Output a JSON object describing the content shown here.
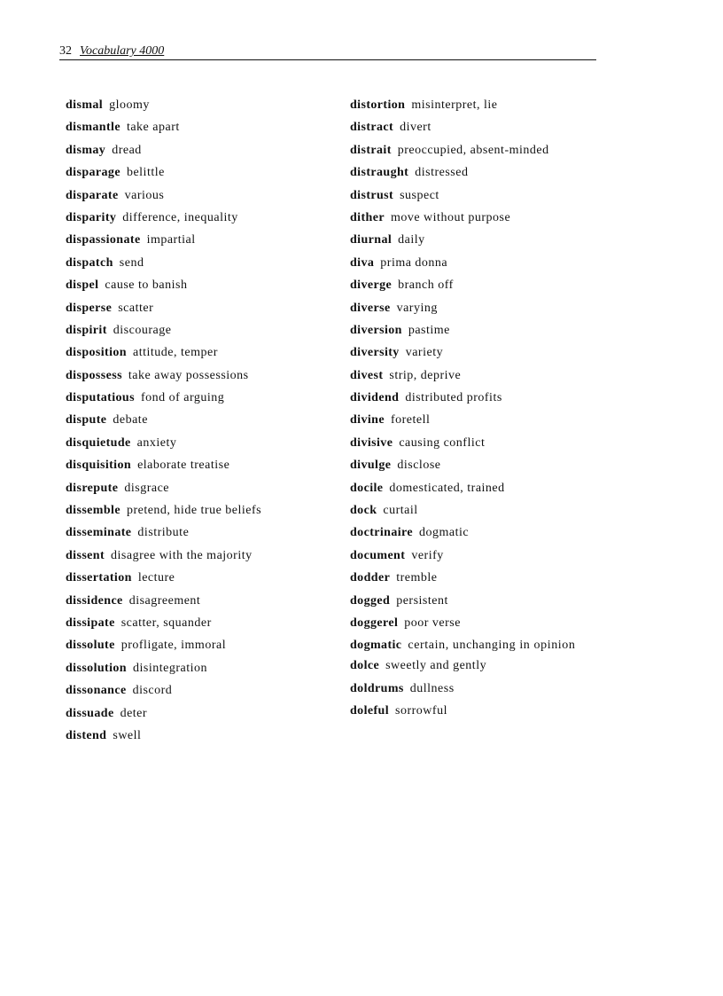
{
  "header": {
    "page_number": "32",
    "book_title": "Vocabulary 4000"
  },
  "left_column": [
    {
      "term": "dismal",
      "definition": "gloomy"
    },
    {
      "term": "dismantle",
      "definition": "take apart"
    },
    {
      "term": "dismay",
      "definition": "dread"
    },
    {
      "term": "disparage",
      "definition": "belittle"
    },
    {
      "term": "disparate",
      "definition": "various"
    },
    {
      "term": "disparity",
      "definition": "difference, inequality"
    },
    {
      "term": "dispassionate",
      "definition": "impartial"
    },
    {
      "term": "dispatch",
      "definition": "send"
    },
    {
      "term": "dispel",
      "definition": "cause to banish"
    },
    {
      "term": "disperse",
      "definition": "scatter"
    },
    {
      "term": "dispirit",
      "definition": "discourage"
    },
    {
      "term": "disposition",
      "definition": "attitude, temper"
    },
    {
      "term": "dispossess",
      "definition": "take away possessions"
    },
    {
      "term": "disputatious",
      "definition": "fond of arguing"
    },
    {
      "term": "dispute",
      "definition": "debate"
    },
    {
      "term": "disquietude",
      "definition": "anxiety"
    },
    {
      "term": "disquisition",
      "definition": "elaborate treatise"
    },
    {
      "term": "disrepute",
      "definition": "disgrace"
    },
    {
      "term": "dissemble",
      "definition": "pretend, hide true beliefs"
    },
    {
      "term": "disseminate",
      "definition": "distribute"
    },
    {
      "term": "dissent",
      "definition": "disagree with the majority"
    },
    {
      "term": "dissertation",
      "definition": "lecture"
    },
    {
      "term": "dissidence",
      "definition": "disagreement"
    },
    {
      "term": "dissipate",
      "definition": "scatter, squander"
    },
    {
      "term": "dissolute",
      "definition": "profligate, immoral"
    },
    {
      "term": "dissolution",
      "definition": "disintegration"
    },
    {
      "term": "dissonance",
      "definition": "discord"
    },
    {
      "term": "dissuade",
      "definition": "deter"
    },
    {
      "term": "distend",
      "definition": "swell"
    }
  ],
  "right_column": [
    {
      "term": "distortion",
      "definition": "misinterpret, lie"
    },
    {
      "term": "distract",
      "definition": "divert"
    },
    {
      "term": "distrait",
      "definition": "preoccupied, absent-minded"
    },
    {
      "term": "distraught",
      "definition": "distressed"
    },
    {
      "term": "distrust",
      "definition": "suspect"
    },
    {
      "term": "dither",
      "definition": "move without purpose"
    },
    {
      "term": "diurnal",
      "definition": "daily"
    },
    {
      "term": "diva",
      "definition": "prima donna"
    },
    {
      "term": "diverge",
      "definition": "branch off"
    },
    {
      "term": "diverse",
      "definition": "varying"
    },
    {
      "term": "diversion",
      "definition": "pastime"
    },
    {
      "term": "diversity",
      "definition": "variety"
    },
    {
      "term": "divest",
      "definition": "strip, deprive"
    },
    {
      "term": "dividend",
      "definition": "distributed profits"
    },
    {
      "term": "divine",
      "definition": "foretell"
    },
    {
      "term": "divisive",
      "definition": "causing conflict"
    },
    {
      "term": "divulge",
      "definition": "disclose"
    },
    {
      "term": "docile",
      "definition": "domesticated, trained"
    },
    {
      "term": "dock",
      "definition": "curtail"
    },
    {
      "term": "doctrinaire",
      "definition": "dogmatic"
    },
    {
      "term": "document",
      "definition": "verify"
    },
    {
      "term": "dodder",
      "definition": "tremble"
    },
    {
      "term": "dogged",
      "definition": "persistent"
    },
    {
      "term": "doggerel",
      "definition": "poor verse"
    },
    {
      "term": "dogmatic",
      "definition": "certain, unchanging in opinion"
    },
    {
      "term": "dolce",
      "definition": "sweetly and gently"
    },
    {
      "term": "doldrums",
      "definition": "dullness"
    },
    {
      "term": "doleful",
      "definition": "sorrowful"
    }
  ]
}
